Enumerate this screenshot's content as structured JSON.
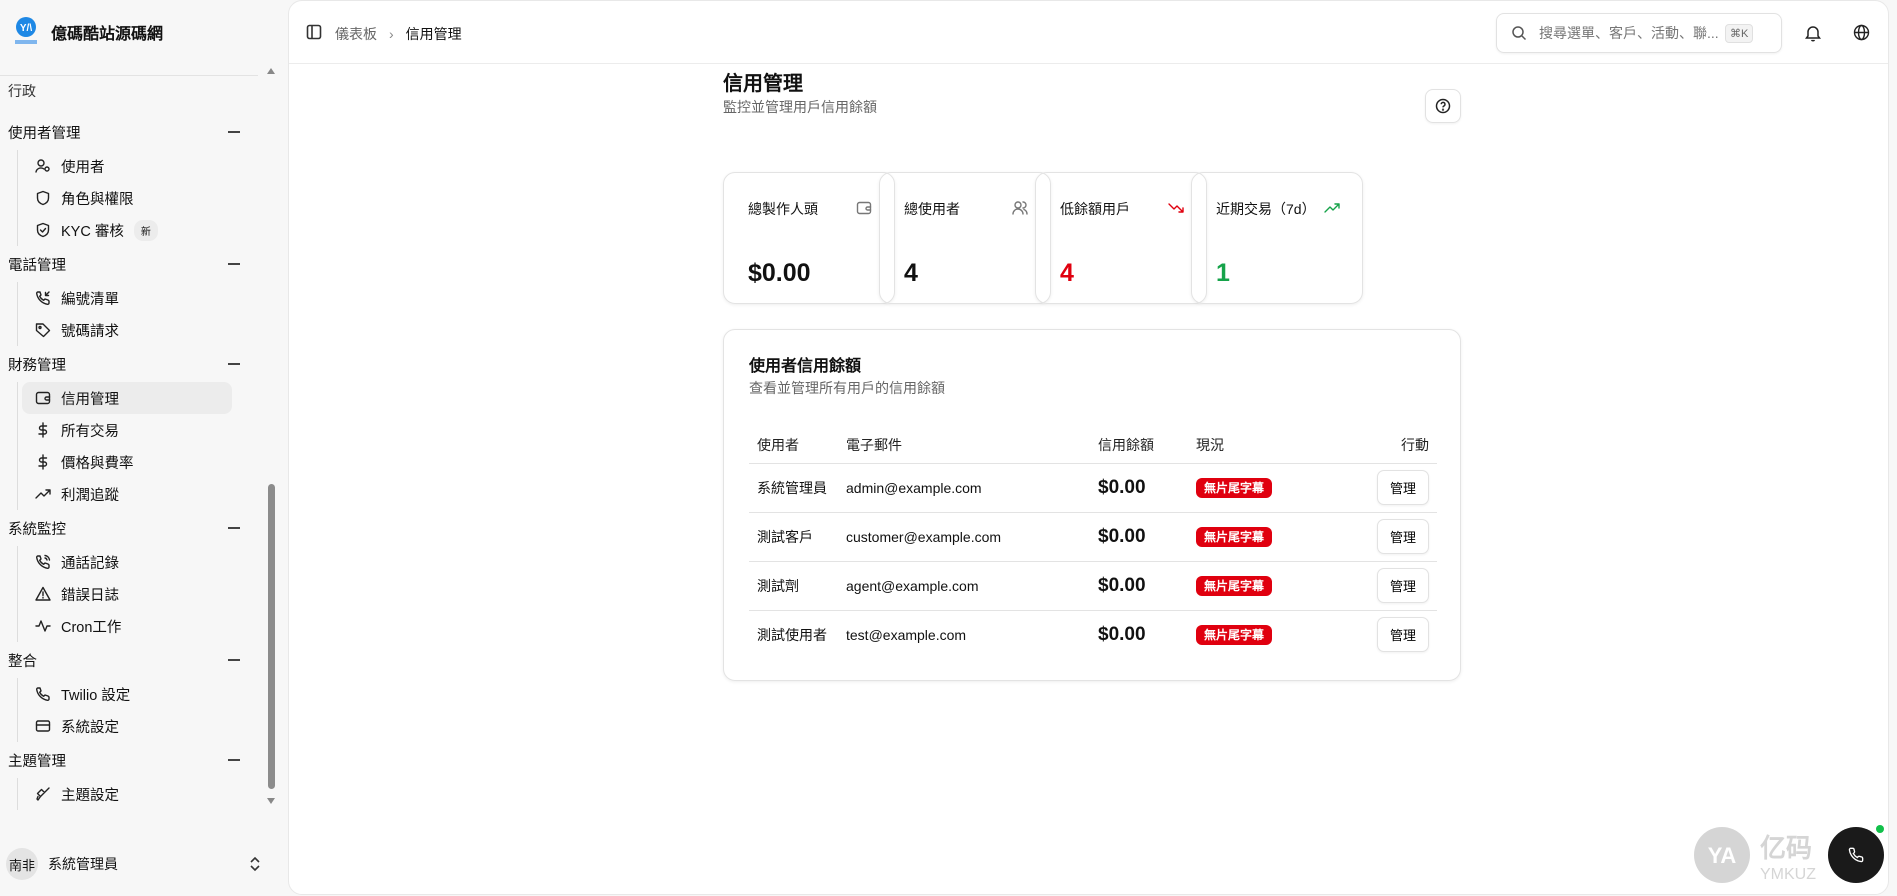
{
  "app": {
    "name": "億碼酷站源碼網",
    "logo_text": "亿码酷站"
  },
  "sidebar": {
    "section": "行政",
    "groups": [
      {
        "label": "使用者管理",
        "items": [
          {
            "label": "使用者",
            "icon": "user-cog-icon"
          },
          {
            "label": "角色與權限",
            "icon": "shield-icon"
          },
          {
            "label": "KYC 審核",
            "icon": "shield-check-icon",
            "badge": "新"
          }
        ]
      },
      {
        "label": "電話管理",
        "items": [
          {
            "label": "編號清單",
            "icon": "phone-incoming-icon"
          },
          {
            "label": "號碼請求",
            "icon": "tag-icon"
          }
        ]
      },
      {
        "label": "財務管理",
        "items": [
          {
            "label": "信用管理",
            "icon": "wallet-icon",
            "active": true
          },
          {
            "label": "所有交易",
            "icon": "dollar-icon"
          },
          {
            "label": "價格與費率",
            "icon": "dollar-icon"
          },
          {
            "label": "利潤追蹤",
            "icon": "trending-up-icon"
          }
        ]
      },
      {
        "label": "系統監控",
        "items": [
          {
            "label": "通話記錄",
            "icon": "phone-call-icon"
          },
          {
            "label": "錯誤日誌",
            "icon": "alert-triangle-icon"
          },
          {
            "label": "Cron工作",
            "icon": "activity-icon"
          }
        ]
      },
      {
        "label": "整合",
        "items": [
          {
            "label": "Twilio 設定",
            "icon": "phone-icon"
          },
          {
            "label": "系統設定",
            "icon": "credit-card-icon"
          }
        ]
      },
      {
        "label": "主題管理",
        "items": [
          {
            "label": "主題設定",
            "icon": "paintbrush-icon"
          }
        ]
      }
    ],
    "user": {
      "avatar": "南非",
      "name": "系統管理員"
    }
  },
  "header": {
    "breadcrumb": [
      "儀表板",
      "信用管理"
    ],
    "search_placeholder": "搜尋選單、客戶、活動、聯...",
    "shortcut": "⌘K"
  },
  "page": {
    "title": "信用管理",
    "subtitle": "監控並管理用戶信用餘額"
  },
  "stats": [
    {
      "label": "總製作人頭",
      "value": "$0.00",
      "icon": "wallet-icon",
      "color": "#111111"
    },
    {
      "label": "總使用者",
      "value": "4",
      "icon": "users-icon",
      "color": "#111111"
    },
    {
      "label": "低餘額用戶",
      "value": "4",
      "icon": "trending-down-icon",
      "color": "#e0000f"
    },
    {
      "label": "近期交易（7d）",
      "value": "1",
      "icon": "trending-up-icon",
      "color": "#16a34a"
    }
  ],
  "table": {
    "title": "使用者信用餘額",
    "subtitle": "查看並管理所有用戶的信用餘額",
    "columns": [
      "使用者",
      "電子郵件",
      "信用餘額",
      "現況",
      "行動"
    ],
    "rows": [
      {
        "user": "系統管理員",
        "email": "admin@example.com",
        "balance": "$0.00",
        "status": "無片尾字幕",
        "action": "管理"
      },
      {
        "user": "測試客戶",
        "email": "customer@example.com",
        "balance": "$0.00",
        "status": "無片尾字幕",
        "action": "管理"
      },
      {
        "user": "測試劑",
        "email": "agent@example.com",
        "balance": "$0.00",
        "status": "無片尾字幕",
        "action": "管理"
      },
      {
        "user": "測試使用者",
        "email": "test@example.com",
        "balance": "$0.00",
        "status": "無片尾字幕",
        "action": "管理"
      }
    ]
  },
  "watermark": {
    "text": "亿码酷站",
    "sub": "YMKUZHAN"
  }
}
